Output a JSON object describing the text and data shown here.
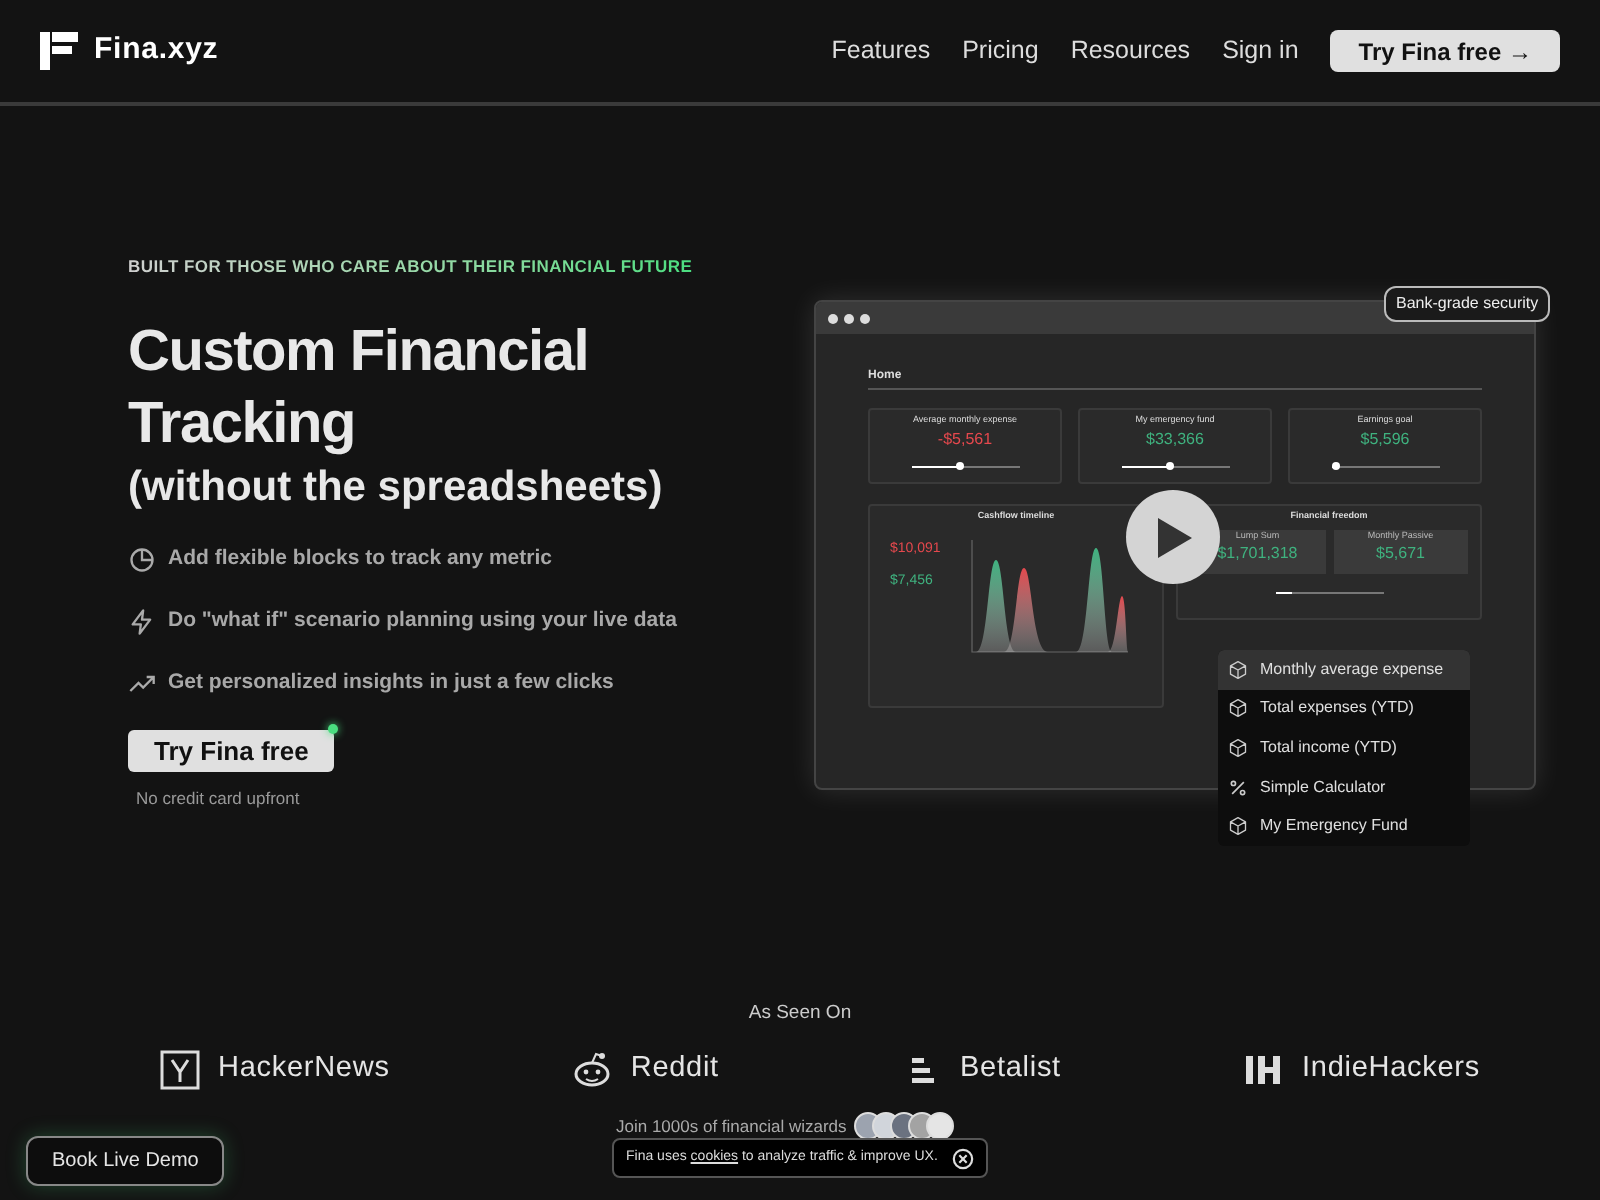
{
  "nav": {
    "brand": "Fina.xyz",
    "links": [
      "Features",
      "Pricing",
      "Resources",
      "Sign in"
    ],
    "cta": "Try Fina free →"
  },
  "hero": {
    "eyebrow": "BUILT FOR THOSE WHO CARE ABOUT THEIR FINANCIAL FUTURE",
    "title": "Custom Financial Tracking",
    "subtitle": "(without the spreadsheets)",
    "features": [
      {
        "kind": "pie",
        "text": "Add flexible blocks to track any metric"
      },
      {
        "kind": "bolt",
        "text": "Do \"what if\" scenario planning using your live data"
      },
      {
        "kind": "trend",
        "text": "Get personalized insights in just a few clicks"
      }
    ],
    "cta": "Try Fina free",
    "note": "No credit card upfront"
  },
  "mockup": {
    "badge": "Bank-grade security",
    "page_title": "Home",
    "cards": [
      {
        "title": "Average monthly expense",
        "value": "-$5,561",
        "color": "#e5484d",
        "level": 0.45
      },
      {
        "title": "My emergency fund",
        "value": "$33,366",
        "color": "#3fb27f",
        "level": 0.45
      },
      {
        "title": "Earnings goal",
        "value": "$5,596",
        "color": "#3fb27f",
        "level": 0.05
      }
    ],
    "cashflow": {
      "title": "Cashflow timeline",
      "expense": "$10,091",
      "income": "$7,456"
    },
    "freedom": {
      "title": "Financial freedom",
      "boxes": [
        {
          "label": "Lump Sum",
          "value": "$1,701,318"
        },
        {
          "label": "Monthly Passive",
          "value": "$5,671"
        }
      ],
      "level": 0.15
    },
    "menu": [
      {
        "kind": "cube",
        "label": "Monthly average expense",
        "selected": true
      },
      {
        "kind": "cube",
        "label": "Total expenses (YTD)",
        "selected": false
      },
      {
        "kind": "cube",
        "label": "Total income (YTD)",
        "selected": false
      },
      {
        "kind": "percent",
        "label": "Simple Calculator",
        "selected": false
      },
      {
        "kind": "cube",
        "label": "My Emergency Fund",
        "selected": false
      }
    ]
  },
  "as_seen_on": {
    "title": "As Seen On",
    "outlets": [
      {
        "kind": "hackernews",
        "name": "HackerNews"
      },
      {
        "kind": "reddit",
        "name": "Reddit"
      },
      {
        "kind": "betalist",
        "name": "Betalist"
      },
      {
        "kind": "indiehackers",
        "name": "IndieHackers"
      }
    ]
  },
  "social_proof": "Join 1000s of financial wizards",
  "cookie": {
    "before": "Fina uses",
    "link": "cookies",
    "after": "to analyze traffic & improve UX."
  },
  "demo_button": "Book Live Demo"
}
